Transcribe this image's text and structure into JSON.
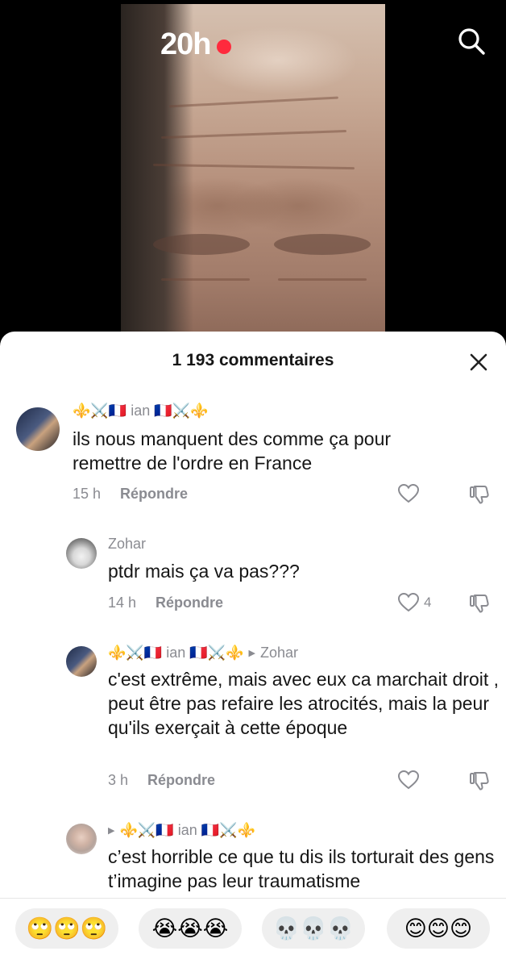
{
  "video": {
    "live_label": "20h",
    "live_dot_color": "#ff2a3d",
    "search_icon": "search-icon"
  },
  "comments_sheet": {
    "count_label": "1 193 commentaires",
    "close_icon": "close-icon",
    "comments": [
      {
        "username": "⚜️⚔️🇫🇷 ian 🇫🇷⚔️⚜️",
        "text": "ils nous manquent des comme ça pour remettre de l'ordre en France",
        "time": "15 h",
        "reply_label": "Répondre",
        "likes": ""
      },
      {
        "username": "Zohar",
        "text": "ptdr mais ça va pas???",
        "time": "14 h",
        "reply_label": "Répondre",
        "likes": "4"
      },
      {
        "username": "⚜️⚔️🇫🇷 ian 🇫🇷⚔️⚜️",
        "reply_to": "Zohar",
        "text": "c'est extrême, mais avec eux ca marchait droit , peut être pas refaire les atrocités, mais la peur qu'ils exerçait à cette époque",
        "time": "3 h",
        "reply_label": "Répondre",
        "likes": ""
      },
      {
        "username": "⚜️⚔️🇫🇷 ian 🇫🇷⚔️⚜️",
        "text": "c’est horrible ce que tu dis ils torturait des gens t’imagine pas leur traumatisme"
      }
    ]
  },
  "emoji_bar": {
    "reactions": [
      "🙄🙄🙄",
      "😭😭😭",
      "💀💀💀",
      "😊😊😊"
    ]
  }
}
